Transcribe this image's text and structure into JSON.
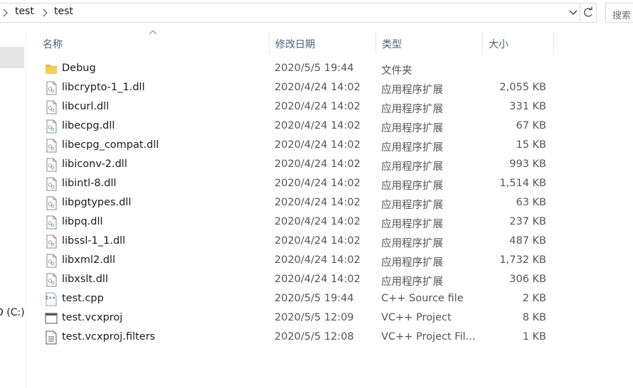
{
  "breadcrumb": [
    "test",
    "test"
  ],
  "search": {
    "placeholder": "搜索"
  },
  "nav": {
    "drive_label": "D (C:)"
  },
  "columns": {
    "name": "名称",
    "date": "修改日期",
    "type": "类型",
    "size": "大小"
  },
  "files": [
    {
      "name": "Debug",
      "date": "2020/5/5 19:44",
      "type": "文件夹",
      "size": "",
      "icon": "folder-icon"
    },
    {
      "name": "libcrypto-1_1.dll",
      "date": "2020/4/24 14:02",
      "type": "应用程序扩展",
      "size": "2,055 KB",
      "icon": "dll-icon"
    },
    {
      "name": "libcurl.dll",
      "date": "2020/4/24 14:02",
      "type": "应用程序扩展",
      "size": "331 KB",
      "icon": "dll-icon"
    },
    {
      "name": "libecpg.dll",
      "date": "2020/4/24 14:02",
      "type": "应用程序扩展",
      "size": "67 KB",
      "icon": "dll-icon"
    },
    {
      "name": "libecpg_compat.dll",
      "date": "2020/4/24 14:02",
      "type": "应用程序扩展",
      "size": "15 KB",
      "icon": "dll-icon"
    },
    {
      "name": "libiconv-2.dll",
      "date": "2020/4/24 14:02",
      "type": "应用程序扩展",
      "size": "993 KB",
      "icon": "dll-icon"
    },
    {
      "name": "libintl-8.dll",
      "date": "2020/4/24 14:02",
      "type": "应用程序扩展",
      "size": "1,514 KB",
      "icon": "dll-icon"
    },
    {
      "name": "libpgtypes.dll",
      "date": "2020/4/24 14:02",
      "type": "应用程序扩展",
      "size": "63 KB",
      "icon": "dll-icon"
    },
    {
      "name": "libpq.dll",
      "date": "2020/4/24 14:02",
      "type": "应用程序扩展",
      "size": "237 KB",
      "icon": "dll-icon"
    },
    {
      "name": "libssl-1_1.dll",
      "date": "2020/4/24 14:02",
      "type": "应用程序扩展",
      "size": "487 KB",
      "icon": "dll-icon"
    },
    {
      "name": "libxml2.dll",
      "date": "2020/4/24 14:02",
      "type": "应用程序扩展",
      "size": "1,732 KB",
      "icon": "dll-icon"
    },
    {
      "name": "libxslt.dll",
      "date": "2020/4/24 14:02",
      "type": "应用程序扩展",
      "size": "306 KB",
      "icon": "dll-icon"
    },
    {
      "name": "test.cpp",
      "date": "2020/5/5 19:44",
      "type": "C++ Source file",
      "size": "2 KB",
      "icon": "cpp-file-icon"
    },
    {
      "name": "test.vcxproj",
      "date": "2020/5/5 12:09",
      "type": "VC++ Project",
      "size": "8 KB",
      "icon": "vcxproj-icon"
    },
    {
      "name": "test.vcxproj.filters",
      "date": "2020/5/5 12:08",
      "type": "VC++ Project Fil...",
      "size": "1 KB",
      "icon": "filters-file-icon"
    }
  ]
}
